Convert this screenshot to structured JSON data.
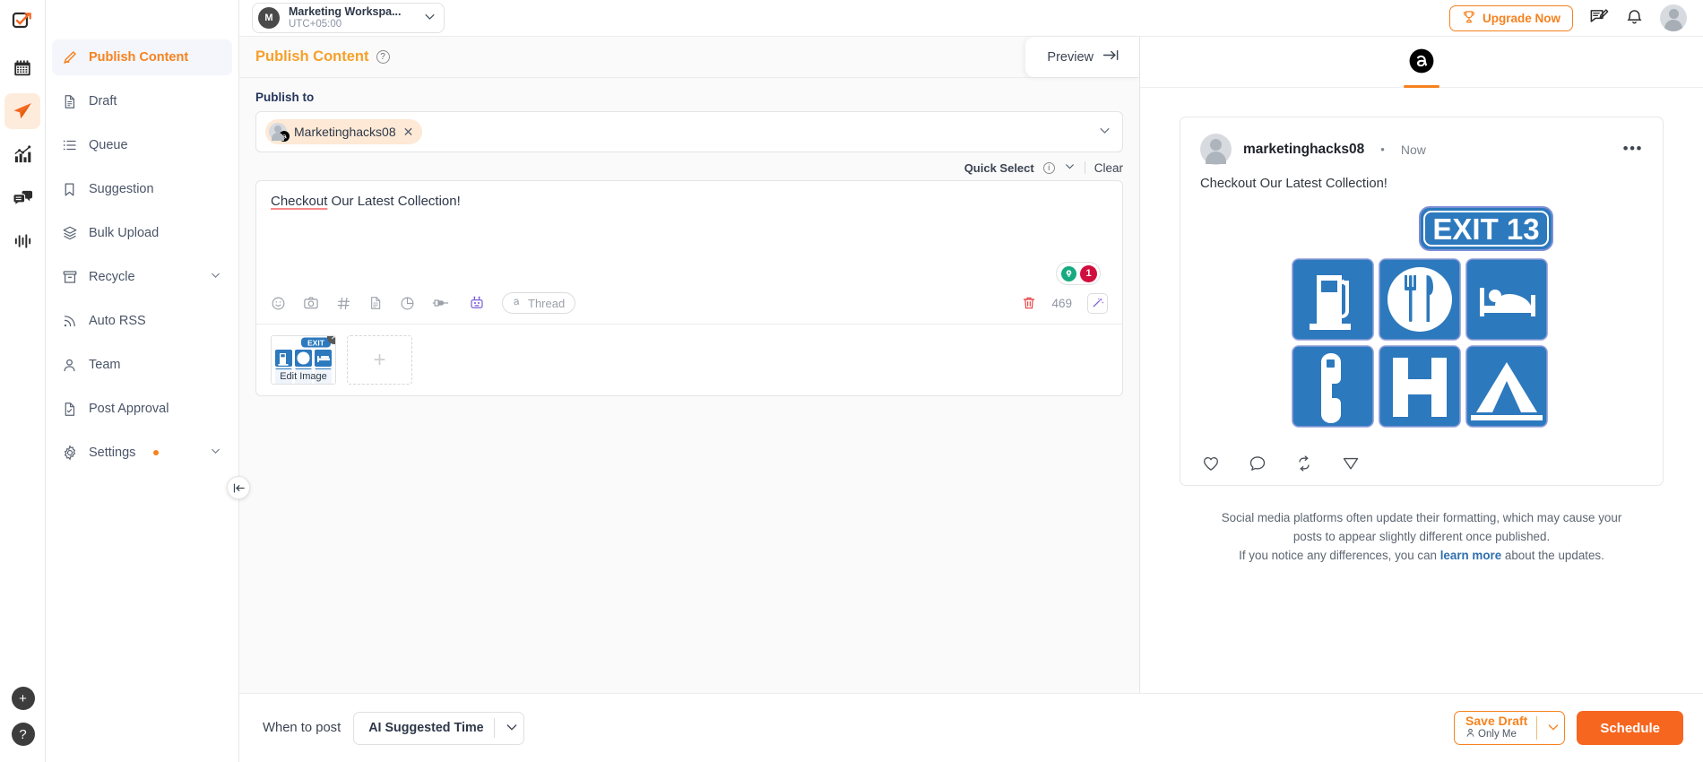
{
  "rail": {
    "items": [
      {
        "name": "logo",
        "icon": "check-square-logo"
      },
      {
        "name": "calendar",
        "icon": "calendar-icon"
      },
      {
        "name": "publish",
        "icon": "paper-plane-icon",
        "active": true
      },
      {
        "name": "analytics",
        "icon": "bar-chart-icon"
      },
      {
        "name": "inbox",
        "icon": "chat-bubbles-icon"
      },
      {
        "name": "reports",
        "icon": "waveform-icon"
      }
    ],
    "add_label": "+",
    "help_label": "?"
  },
  "workspace": {
    "initial": "M",
    "name": "Marketing Workspa...",
    "timezone": "UTC+05:00"
  },
  "header": {
    "upgrade_label": "Upgrade Now",
    "trophy_icon": "trophy-icon",
    "feedback_icon": "feedback-icon",
    "notification_icon": "bell-icon",
    "avatar_icon": "user-avatar"
  },
  "sidebar": {
    "items": [
      {
        "label": "Publish Content",
        "icon": "pencil-icon",
        "active": true,
        "chevron": false,
        "dot": false
      },
      {
        "label": "Draft",
        "icon": "document-icon",
        "active": false,
        "chevron": false,
        "dot": false
      },
      {
        "label": "Queue",
        "icon": "list-icon",
        "active": false,
        "chevron": false,
        "dot": false
      },
      {
        "label": "Suggestion",
        "icon": "bookmark-icon",
        "active": false,
        "chevron": false,
        "dot": false
      },
      {
        "label": "Bulk Upload",
        "icon": "layers-icon",
        "active": false,
        "chevron": false,
        "dot": false
      },
      {
        "label": "Recycle",
        "icon": "archive-icon",
        "active": false,
        "chevron": true,
        "dot": false
      },
      {
        "label": "Auto RSS",
        "icon": "rss-icon",
        "active": false,
        "chevron": false,
        "dot": false
      },
      {
        "label": "Team",
        "icon": "person-icon",
        "active": false,
        "chevron": false,
        "dot": false
      },
      {
        "label": "Post Approval",
        "icon": "document-check-icon",
        "active": false,
        "chevron": false,
        "dot": false
      },
      {
        "label": "Settings",
        "icon": "gear-icon",
        "active": false,
        "chevron": true,
        "dot": true
      }
    ],
    "collapse_icon": "collapse-left-icon"
  },
  "editor": {
    "title": "Publish Content",
    "help_icon": "question-mark-icon",
    "preview_tab_label": "Preview",
    "preview_arrow_icon": "arrow-right-to-line-icon",
    "publish_to_label": "Publish to",
    "account_chip": {
      "name": "Marketinghacks08",
      "platform_icon": "threads-icon",
      "remove_icon": "close-icon"
    },
    "quick_select_label": "Quick Select",
    "quick_select_info_icon": "info-icon",
    "quick_select_chevron": "chevron-down-icon",
    "clear_label": "Clear",
    "post_text_first": "Checkout",
    "post_text_rest": " Our Latest Collection!",
    "idea_count": "1",
    "idea_icon": "lightbulb-icon",
    "char_count": "469",
    "trash_icon": "trash-icon",
    "magic_icon": "magic-wand-icon",
    "toolbar_icons": [
      {
        "name": "emoji-icon"
      },
      {
        "name": "camera-icon"
      },
      {
        "name": "hashtag-icon"
      },
      {
        "name": "file-icon"
      },
      {
        "name": "pie-chart-icon"
      },
      {
        "name": "plug-icon"
      },
      {
        "name": "robot-icon"
      }
    ],
    "thread_pill_label": "Thread",
    "thread_pill_icon": "threads-icon",
    "media": {
      "edit_label": "Edit Image",
      "remove_icon": "close-icon",
      "add_label": "+",
      "sign_exit_text": "EXIT 13"
    }
  },
  "preview": {
    "platform_tab_icon": "threads-icon",
    "account_name": "marketinghacks08",
    "separator": "•",
    "time_label": "Now",
    "more_icon": "ellipsis-icon",
    "post_text": "Checkout Our Latest Collection!",
    "image_exit_text": "EXIT 13",
    "actions": [
      {
        "name": "like-icon"
      },
      {
        "name": "comment-icon"
      },
      {
        "name": "repost-icon"
      },
      {
        "name": "share-icon"
      }
    ],
    "disclaimer_line1": "Social media platforms often update their formatting, which may cause your",
    "disclaimer_line2": "posts to appear slightly different once published.",
    "disclaimer_line3_pre": "If you notice any differences, you can ",
    "disclaimer_link": "learn more",
    "disclaimer_line3_post": " about the updates."
  },
  "footer": {
    "when_label": "When to post",
    "time_value": "AI Suggested Time",
    "time_chevron": "chevron-down-icon",
    "save_draft_label": "Save Draft",
    "save_draft_sub": "Only Me",
    "save_draft_person_icon": "person-icon",
    "save_draft_chevron": "chevron-down-icon",
    "schedule_label": "Schedule"
  },
  "colors": {
    "brand_orange": "#f6821f",
    "schedule_orange": "#f6661f",
    "link_blue": "#2f6fae",
    "badge_red": "#d10f3e",
    "sign_blue": "#2d79bd"
  }
}
